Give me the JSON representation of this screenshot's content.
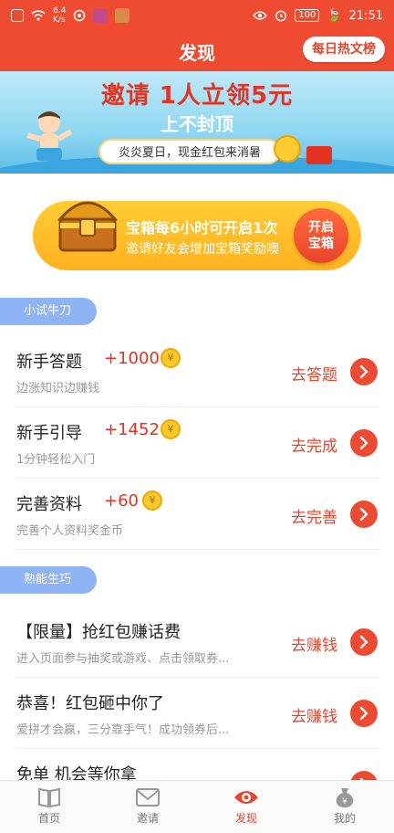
{
  "status_bar": {
    "net_speed": "6.4",
    "net_unit": "K/s",
    "battery": "100",
    "time": "21:51"
  },
  "header": {
    "title": "发现",
    "hot_button": "每日热文榜"
  },
  "banner": {
    "headline": "邀请 1人立领5元",
    "subline": "上不封顶",
    "pill": "炎炎夏日，现金红包来消暑"
  },
  "chest": {
    "line1": "宝箱每6小时可开启1次",
    "line2": "邀请好友会增加宝箱奖励噢",
    "button_line1": "开启",
    "button_line2": "宝箱"
  },
  "sections": [
    {
      "tag": "小试牛刀",
      "tasks": [
        {
          "title": "新手答题",
          "points": "+1000",
          "sub": "边涨知识边赚钱",
          "action": "去答题"
        },
        {
          "title": "新手引导",
          "points": "+1452",
          "sub": "1分钟轻松入门",
          "action": "去完成"
        },
        {
          "title": "完善资料",
          "points": "+60",
          "sub": "完善个人资料奖金币",
          "action": "去完善"
        }
      ]
    },
    {
      "tag": "熟能生巧",
      "tasks": [
        {
          "title": "【限量】抢红包赚话费",
          "sub": "进入页面参与抽奖或游戏、点击领取券...",
          "action": "去赚钱"
        },
        {
          "title": "恭喜！红包砸中你了",
          "sub": "爱拼才会赢，三分靠手气！成功领券后...",
          "action": "去赚钱"
        },
        {
          "title": "免单 机会等你拿"
        }
      ]
    }
  ],
  "coin_symbol": "¥",
  "tabbar": [
    {
      "label": "首页",
      "icon": "book-icon"
    },
    {
      "label": "邀请",
      "icon": "envelope-icon"
    },
    {
      "label": "发现",
      "icon": "eye-icon",
      "active": true
    },
    {
      "label": "我的",
      "icon": "money-bag-icon"
    }
  ],
  "colors": {
    "brand": "#ee4b30",
    "accent": "#e8452b",
    "tag": "#8fb4f5",
    "chest": "#ffbe2a"
  }
}
